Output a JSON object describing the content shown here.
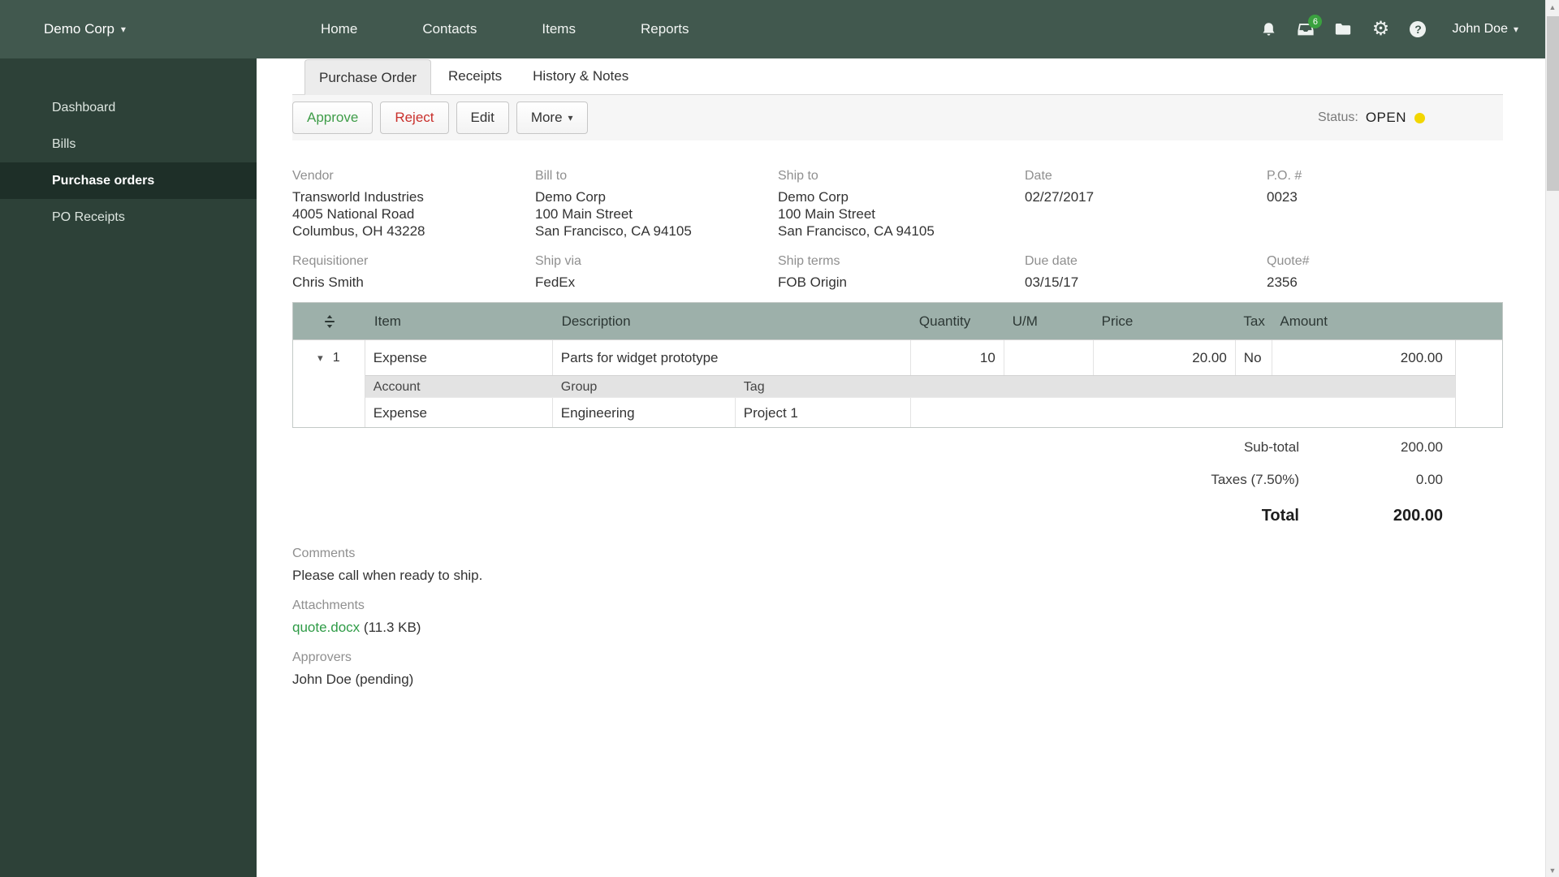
{
  "navbar": {
    "company": "Demo Corp",
    "links": {
      "home": "Home",
      "contacts": "Contacts",
      "items": "Items",
      "reports": "Reports"
    },
    "notification_count": "6",
    "user_name": "John Doe"
  },
  "sidebar": {
    "dashboard": "Dashboard",
    "bills": "Bills",
    "purchase_orders": "Purchase orders",
    "po_receipts": "PO Receipts"
  },
  "tabs": {
    "purchase_order": "Purchase Order",
    "receipts": "Receipts",
    "history": "History & Notes"
  },
  "toolbar": {
    "approve": "Approve",
    "reject": "Reject",
    "edit": "Edit",
    "more": "More"
  },
  "status": {
    "label": "Status:",
    "value": "OPEN"
  },
  "details": {
    "vendor": {
      "label": "Vendor",
      "line1": "Transworld Industries",
      "line2": "4005 National Road",
      "line3": "Columbus, OH 43228"
    },
    "bill_to": {
      "label": "Bill to",
      "line1": "Demo Corp",
      "line2": "100 Main Street",
      "line3": "San Francisco, CA 94105"
    },
    "ship_to": {
      "label": "Ship to",
      "line1": "Demo Corp",
      "line2": "100 Main Street",
      "line3": "San Francisco, CA 94105"
    },
    "date": {
      "label": "Date",
      "value": "02/27/2017"
    },
    "po_number": {
      "label": "P.O. #",
      "value": "0023"
    },
    "requisitioner": {
      "label": "Requisitioner",
      "value": "Chris Smith"
    },
    "ship_via": {
      "label": "Ship via",
      "value": "FedEx"
    },
    "ship_terms": {
      "label": "Ship terms",
      "value": "FOB Origin"
    },
    "due_date": {
      "label": "Due date",
      "value": "03/15/17"
    },
    "quote": {
      "label": "Quote#",
      "value": "2356"
    }
  },
  "line_items": {
    "headers": {
      "item": "Item",
      "description": "Description",
      "quantity": "Quantity",
      "um": "U/M",
      "price": "Price",
      "tax": "Tax",
      "amount": "Amount"
    },
    "row": {
      "number": "1",
      "item": "Expense",
      "description": "Parts for widget prototype",
      "quantity": "10",
      "um": "",
      "price": "20.00",
      "tax": "No",
      "amount": "200.00"
    },
    "sub_headers": {
      "account": "Account",
      "group": "Group",
      "tag": "Tag"
    },
    "sub_row": {
      "account": "Expense",
      "group": "Engineering",
      "tag": "Project 1"
    }
  },
  "totals": {
    "subtotal_label": "Sub-total",
    "subtotal": "200.00",
    "tax_label": "Taxes (7.50%)",
    "tax": "0.00",
    "total_label": "Total",
    "total": "200.00"
  },
  "comments": {
    "label": "Comments",
    "text": "Please call when ready to ship."
  },
  "attachments": {
    "label": "Attachments",
    "file_name": "quote.docx",
    "file_size": "(11.3 KB)"
  },
  "approvers": {
    "label": "Approvers",
    "value": "John Doe (pending)"
  }
}
